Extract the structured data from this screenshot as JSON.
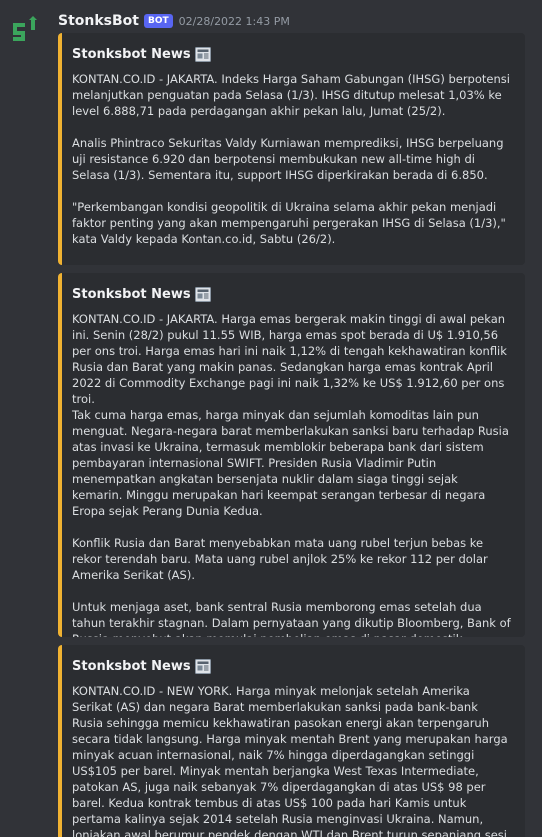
{
  "message": {
    "username": "StonksBot",
    "bot_tag": "BOT",
    "timestamp": "02/28/2022 1:43 PM",
    "avatar_color": "#3ba55c"
  },
  "embed_color": "#f0b232",
  "embeds": [
    {
      "title": "Stonksbot News",
      "icon": "newspaper-icon",
      "paragraphs": [
        "KONTAN.CO.ID - JAKARTA. Indeks Harga Saham Gabungan (IHSG) berpotensi melanjutkan penguatan pada Selasa (1/3). IHSG ditutup melesat 1,03% ke level 6.888,71 pada perdagangan akhir pekan lalu, Jumat (25/2).",
        "Analis Phintraco Sekuritas Valdy Kurniawan memprediksi, IHSG berpeluang uji resistance 6.920 dan berpotensi membukukan new all-time high di Selasa (1/3). Sementara itu, support IHSG diperkirakan berada di 6.850.",
        "\"Perkembangan kondisi geopolitik di Ukraina selama akhir pekan menjadi faktor penting yang akan mempengaruhi pergerakan IHSG di Selasa (1/3),\" kata Valdy kepada Kontan.co.id, Sabtu (26/2)."
      ]
    },
    {
      "title": "Stonksbot News",
      "icon": "newspaper-icon",
      "paragraphs": [
        "KONTAN.CO.ID - JAKARTA. Harga emas bergerak makin tinggi di awal pekan ini. Senin (28/2) pukul 11.55 WIB, harga emas spot berada di U$ 1.910,56 per ons troi. Harga emas hari ini naik 1,12% di tengah kekhawatiran konflik Rusia dan Barat yang makin panas. Sedangkan harga emas kontrak April 2022 di Commodity Exchange pagi ini naik 1,32% ke US$ 1.912,60 per ons troi.\nTak cuma harga emas, harga minyak dan sejumlah komoditas lain pun menguat. Negara-negara barat memberlakukan sanksi baru terhadap Rusia atas invasi ke Ukraina, termasuk memblokir beberapa bank dari sistem pembayaran internasional SWIFT. Presiden Rusia Vladimir Putin menempatkan angkatan bersenjata nuklir dalam siaga tinggi sejak kemarin. Minggu merupakan hari keempat serangan terbesar di negara Eropa sejak Perang Dunia Kedua.",
        "Konflik Rusia dan Barat menyebabkan mata uang rubel terjun bebas ke rekor terendah baru. Mata uang rubel anjlok 25% ke rekor 112 per dolar Amerika Serikat (AS).",
        "Untuk menjaga aset, bank sentral Rusia memborong emas setelah dua tahun terakhir stagnan. Dalam pernyataan yang dikutip Bloomberg, Bank of Russia menyebut akan memulai pembelian emas di pasar domestik."
      ]
    },
    {
      "title": "Stonksbot News",
      "icon": "newspaper-icon",
      "paragraphs": [
        "KONTAN.CO.ID - NEW YORK. Harga minyak melonjak setelah Amerika Serikat (AS) dan negara Barat memberlakukan sanksi pada bank-bank Rusia sehingga memicu kekhawatiran pasokan energi akan terpengaruh secara tidak langsung. Harga minyak mentah Brent yang merupakan harga minyak acuan internasional, naik 7% hingga diperdagangkan setinggi US$105 per barel. Minyak mentah berjangka West Texas Intermediate, patokan AS, juga naik sebanyak 7% diperdagangkan di atas US$ 98 per barel. Kedua kontrak tembus di atas US$ 100 pada hari Kamis untuk pertama kalinya sejak 2014 setelah Rusia menginvasi Ukraina. Namun, lonjakan awal berumur pendek dengan WTI dan Brent turun sepanjang sesi Kamis dan"
      ]
    }
  ]
}
